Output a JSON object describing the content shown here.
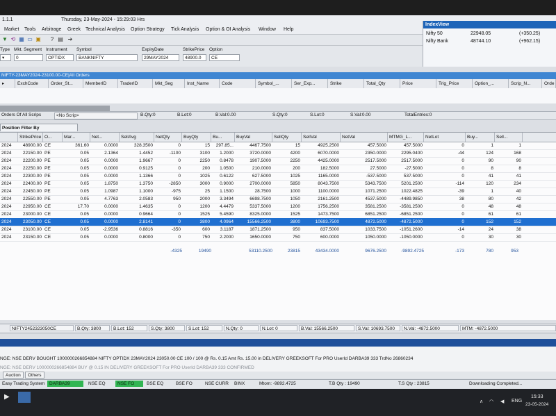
{
  "app": {
    "version": "1.1.1",
    "datetime": "Thursday, 23-May-2024 - 15:29:03 Hrs"
  },
  "menu": [
    "Market",
    "Tools",
    "Arbitrage",
    "Greek",
    "Technical Analysis",
    "Option Strategy",
    "Tick Analysis",
    "Option & OI Analysis",
    "Window",
    "Help"
  ],
  "filters": {
    "type_label": "Type",
    "mkt_segment_label": "Mkt. Segment",
    "instrument_label": "Instrument",
    "symbol_label": "Symbol",
    "expiry_label": "ExpiryDate",
    "strike_label": "StrikePrice",
    "option_label": "Option",
    "mkt_segment_value": "0",
    "instrument_value": "OPTIDX",
    "symbol_value": "BANKNIFTY",
    "expiry_value": "29MAY2024",
    "strike_value": "48900.0",
    "option_value": "CE"
  },
  "index_view": {
    "title": "IndexView",
    "rows": [
      {
        "name": "Nifty 50",
        "value": "22948.05",
        "change": "(+350.25)"
      },
      {
        "name": "Nifty Bank",
        "value": "48744.10",
        "change": "(+962.15)"
      }
    ]
  },
  "order_window": {
    "title": "NIFTY-23MAY2024-23100.00-CE|All Orders",
    "columns": [
      "ExchCode",
      "Order_St...",
      "MemberID",
      "TraderID",
      "Mkt_Seg",
      "Inst_Name",
      "Code",
      "Symbol_...",
      "Ser_Exp...",
      "Strike",
      "Total_Qty",
      "Price",
      "Trig_Price",
      "Option_...",
      "Scrip_N...",
      "Orde"
    ]
  },
  "orders_status": {
    "title": "Orders Of All Scrips",
    "scrip": "<No Scrip>",
    "bqty": "B.Qty:0",
    "blot": "B.Lot:0",
    "bval": "B.Val:0.00",
    "sqty": "S.Qty:0",
    "slot": "S.Lot:0",
    "sval": "S.Val:0.00",
    "total_entries": "TotalEntries:0"
  },
  "positions": {
    "tab_title": "Position Filter By (Periodicity,Daily)",
    "columns": [
      "",
      "StrikePrice",
      "O...",
      "Mar...",
      "Net...",
      "SellAvg",
      "NetQty",
      "BuyQty",
      "Bu...",
      "BuyVal",
      "SellQty",
      "SellVal",
      "NetVal",
      "MTMG_L...",
      "NetLot",
      "Buy...",
      "Sell..."
    ],
    "rows": [
      [
        "2024",
        "48900.00",
        "CE",
        "361.60",
        "0.0000",
        "328.3500",
        "0",
        "15",
        "297.85...",
        "4467.7500",
        "15",
        "4925.2500",
        "457.5000",
        "457.5000",
        "0",
        "1",
        "1"
      ],
      [
        "2024",
        "22150.00",
        "PE",
        "0.05",
        "2.1364",
        "1.4452",
        "-1100",
        "3100",
        "1.2000",
        "3720.0000",
        "4200",
        "6070.0000",
        "2350.0000",
        "2295.0400",
        "-44",
        "124",
        "168"
      ],
      [
        "2024",
        "22200.00",
        "PE",
        "0.05",
        "0.0000",
        "1.9667",
        "0",
        "2250",
        "0.8478",
        "1907.5000",
        "2250",
        "4425.0000",
        "2517.5000",
        "2517.5000",
        "0",
        "90",
        "90"
      ],
      [
        "2024",
        "22250.00",
        "PE",
        "0.05",
        "0.0000",
        "0.9125",
        "0",
        "200",
        "1.0500",
        "210.0000",
        "200",
        "182.5000",
        "27.5000",
        "-27.5000",
        "0",
        "8",
        "8"
      ],
      [
        "2024",
        "22300.00",
        "PE",
        "0.05",
        "0.0000",
        "1.1366",
        "0",
        "1025",
        "0.6122",
        "627.5000",
        "1025",
        "1165.0000",
        "-537.5000",
        "537.5000",
        "0",
        "41",
        "41"
      ],
      [
        "2024",
        "22400.00",
        "PE",
        "0.05",
        "1.8750",
        "1.3750",
        "-2850",
        "3000",
        "0.9000",
        "2700.0000",
        "5850",
        "8043.7500",
        "5343.7500",
        "5201.2500",
        "-114",
        "120",
        "234"
      ],
      [
        "2024",
        "22450.00",
        "PE",
        "0.05",
        "1.0987",
        "1.1000",
        "-975",
        "25",
        "1.1500",
        "28.7500",
        "1000",
        "1100.0000",
        "1071.2500",
        "1022.4825",
        "-39",
        "1",
        "40"
      ],
      [
        "2024",
        "22550.00",
        "PE",
        "0.05",
        "4.7763",
        "2.0583",
        "950",
        "2000",
        "3.3494",
        "6698.7500",
        "1050",
        "2161.2500",
        "4537.5000",
        "-4489.9850",
        "38",
        "80",
        "42"
      ],
      [
        "2024",
        "22950.00",
        "CE",
        "17.70",
        "0.0000",
        "1.4635",
        "0",
        "1200",
        "4.4479",
        "5337.5000",
        "1200",
        "1756.2500",
        "3581.2500",
        "-3581.2500",
        "0",
        "48",
        "48"
      ],
      [
        "2024",
        "23000.00",
        "CE",
        "0.05",
        "0.0000",
        "0.9664",
        "0",
        "1525",
        "5.4590",
        "8325.0000",
        "1525",
        "1473.7500",
        "6851.2500",
        "-6851.2500",
        "0",
        "61",
        "61"
      ],
      [
        "2024",
        "23050.00",
        "CE",
        "0.05",
        "0.0000",
        "2.8141",
        "0",
        "3800",
        "4.0964",
        "15566.2500",
        "3800",
        "10693.7500",
        "4872.5000",
        "-4872.5000",
        "0",
        "152",
        "152"
      ],
      [
        "2024",
        "23100.00",
        "CE",
        "0.05",
        "-2.9536",
        "0.8816",
        "-350",
        "600",
        "3.1187",
        "1871.2500",
        "950",
        "837.5000",
        "1033.7500",
        "-1051.2600",
        "-14",
        "24",
        "38"
      ],
      [
        "2024",
        "23150.00",
        "CE",
        "0.05",
        "0.0000",
        "0.8000",
        "0",
        "750",
        "2.2000",
        "1650.0000",
        "750",
        "600.0000",
        "1050.0000",
        "-1050.0000",
        "0",
        "30",
        "30"
      ]
    ],
    "selected_row": 10,
    "totals": {
      "netqty": "-4325",
      "buyqty": "19490",
      "buyval": "53110.2500",
      "sellqty": "23815",
      "sellval": "43434.0000",
      "netval": "9676.2500",
      "mtm": "-9892.4725",
      "netlot": "-173",
      "buylot": "780",
      "selllot": "953"
    }
  },
  "position_status": {
    "scrip": "NIFTY2452323050CE",
    "bqty": "B.Qty: 3800",
    "blot": "B.Lot: 152",
    "sqty": "S.Qty: 3800",
    "slot": "S.Lot: 152",
    "nqty": "N.Qty: 0",
    "nlot": "N.Lot: 0",
    "bval": "B.Val: 15566.2500",
    "sval": "S.Val: 10693.7500",
    "nval": "N.Val: -4872.5000",
    "mtm": "MTM: -4872.5000"
  },
  "messages": [
    "NGE: NSE DERV BOUGHT 1000000266854884 NIFTY OPTIDX 23MAY2024 23050.00 CE 100 / 100 @ Rs. 0.15 Amt Rs. 15.00 in DELIVERY GREEKSOFT For PRO UserId DARBA39  333  TrdNo 26860234",
    "NGE: NSE DERV 1000000266854884 BUY @ 0.15 IN DELIVERY GREEKSOFT For PRO UserId DARBA39  333  CONFIRMED"
  ],
  "tabs": [
    "Auction",
    "Others"
  ],
  "statusbar": {
    "app_name": "Easy Trading System",
    "user": "DARBA39",
    "segments": [
      "NSE EQ",
      "NSE FO",
      "BSE EQ",
      "BSE FO",
      "NSE CURR",
      "BINX"
    ],
    "mtom": "Mtom: -9892.4725",
    "tb_qty": "T.B Qty : 19490",
    "ts_qty": "T.S Qty : 23815",
    "download": "Downloading Completed..."
  },
  "taskbar": {
    "lang": "ENG",
    "time": "15:33",
    "date": "23-05-2024"
  },
  "colors": {
    "accent": "#1d64b8",
    "selected_row": "#1f6fd0",
    "status_green": "#31b552"
  }
}
